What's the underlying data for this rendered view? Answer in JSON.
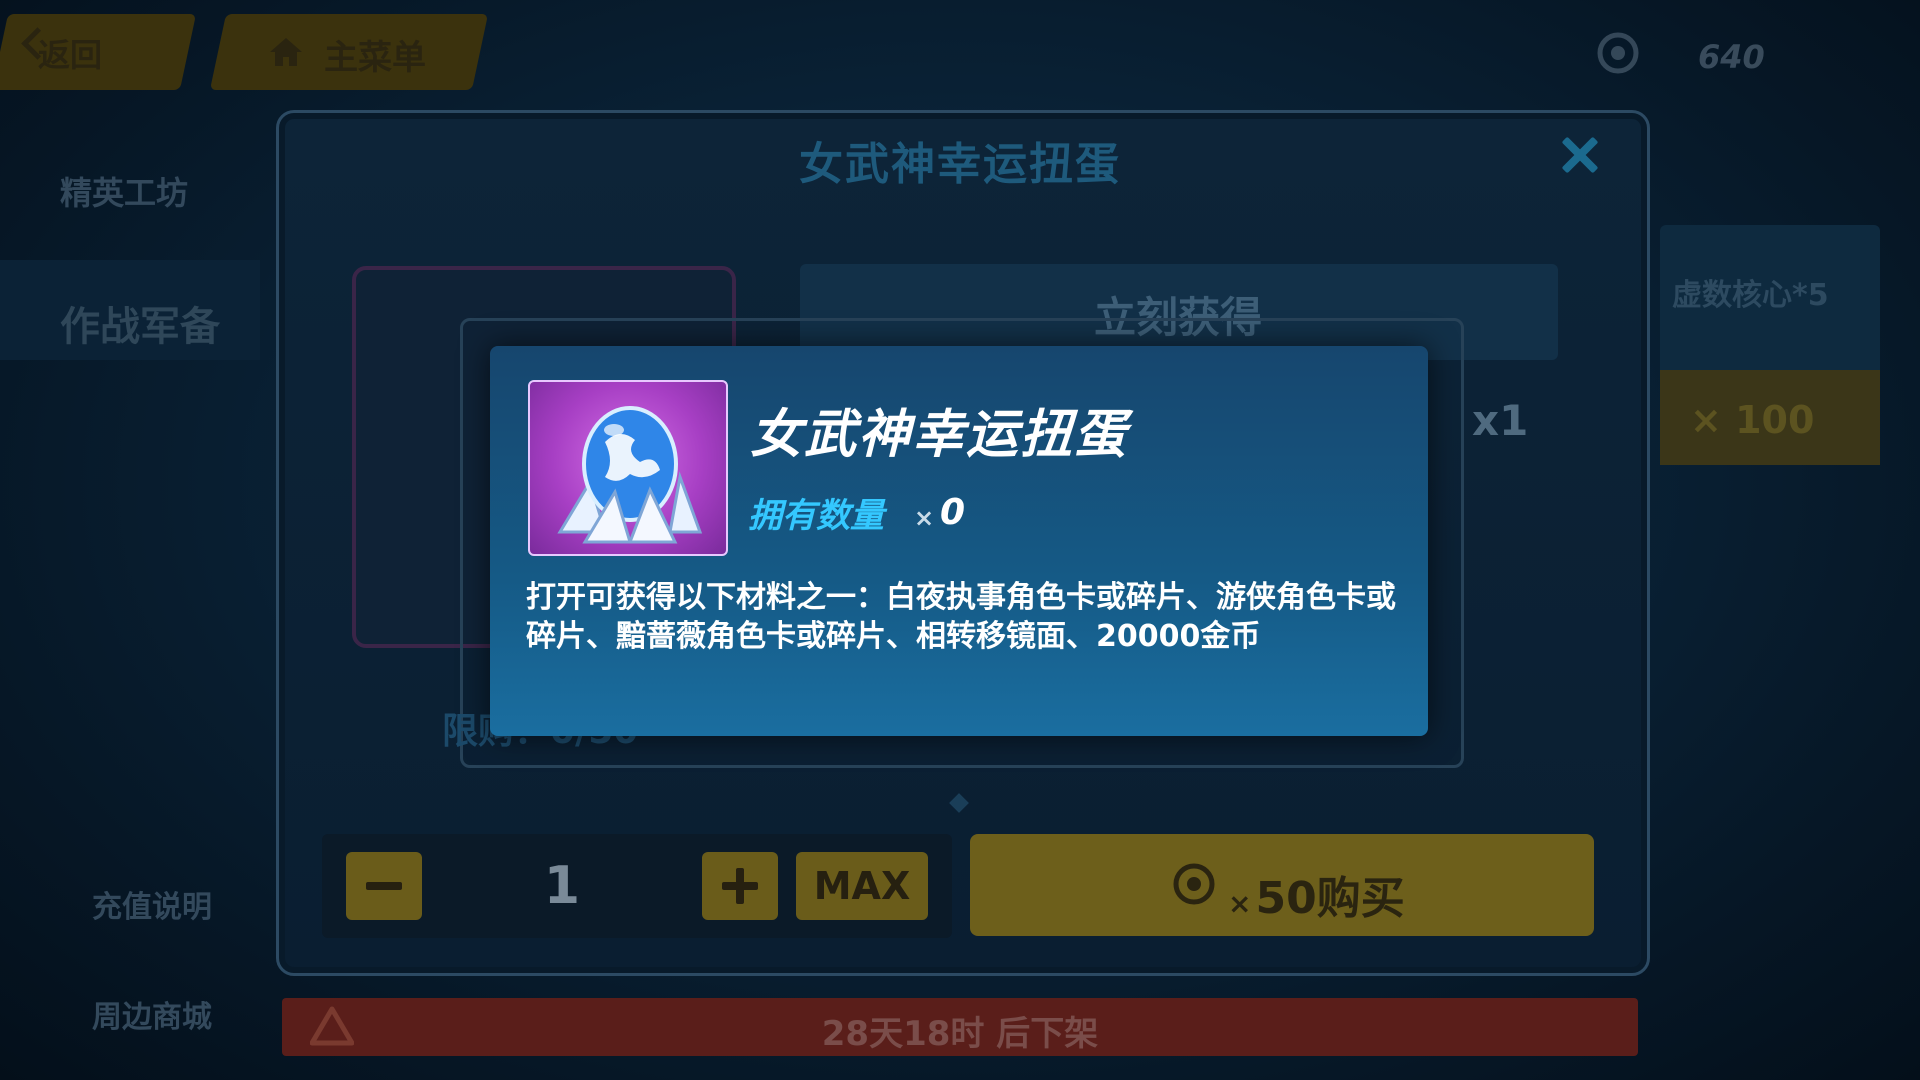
{
  "topbar": {
    "back_label": "返回",
    "home_label": "主菜单",
    "currency_value": "640",
    "currency_icon": "gear-coin-icon"
  },
  "sidebar": {
    "items": [
      "精英工坊",
      "作战军备",
      "充值说明",
      "周边商城"
    ]
  },
  "background": {
    "get_now": "立刻获得",
    "x1": "x1",
    "limit": "限购：0/50",
    "right_text1": "虚数核心*5",
    "right_text2": "× 100",
    "timer": "28天18时 后下架"
  },
  "dialog": {
    "title": "女武神幸运扭蛋",
    "close_icon": "close-icon"
  },
  "tooltip": {
    "item_name": "女武神幸运扭蛋",
    "owned_label": "拥有数量",
    "owned_x": "×",
    "owned_value": "0",
    "description": "打开可获得以下材料之一：白夜执事角色卡或碎片、游侠角色卡或碎片、黯蔷薇角色卡或碎片、相转移镜面、20000金币",
    "item_icon": "gacha-egg-icon",
    "item_frame_color": "#b14fd0"
  },
  "purchase": {
    "quantity": "1",
    "max_label": "MAX",
    "buy_x": "×",
    "buy_label": "50购买",
    "accent": "#6d5f1b"
  }
}
